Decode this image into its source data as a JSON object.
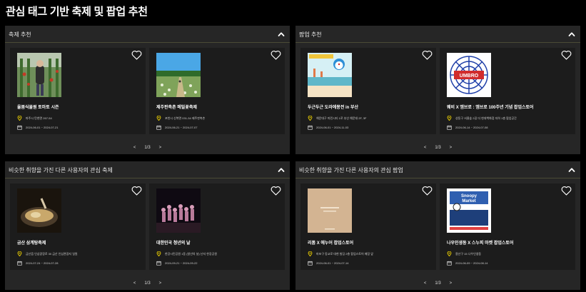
{
  "page_title": "관심 태그 기반 축제 및 팝업 추천",
  "sections": [
    {
      "title": "축제 추천",
      "pager": {
        "prev": "<",
        "page": "1/3",
        "next": ">"
      },
      "cards": [
        {
          "title": "율봄식물원 토마토 시즌",
          "address": "파주시 탄현면 267-54",
          "dates": "2024-06-01 ~ 2024-07-21",
          "thumb": "tomato-farm-photo"
        },
        {
          "title": "제주판촉촌 메밀꽃축제",
          "address": "포천시 신북면 031-34 제주판촉촌",
          "dates": "2024-06-21 ~ 2024-07-07",
          "thumb": "buckwheat-field-photo"
        }
      ]
    },
    {
      "title": "팝업 추천",
      "pager": {
        "prev": "<",
        "page": "1/3",
        "next": ">"
      },
      "cards": [
        {
          "title": "두근두근 도라에몽전 in 부산",
          "address": "해운대구 마린시티 1로 부산 해운대 2F, 3F",
          "dates": "2024-06-01 ~ 2024-11-03",
          "thumb": "doraemon-poster"
        },
        {
          "title": "웨비 X 엠브로 : 엠브로 100주년 기념 팝업스토어",
          "address": "성동구 서울숲 2길 더 현대백화점 지하 1층 팝업공간",
          "dates": "2024-06-14 ~ 2024-07-08",
          "thumb": "umbro-logo"
        }
      ]
    },
    {
      "title": "비슷한 취향을 가진 다른 사용자의 관심 축제",
      "pager": {
        "prev": "<",
        "page": "1/3",
        "next": ">"
      },
      "cards": [
        {
          "title": "금산 삼계탕축제",
          "address": "금산읍 인삼광장로 30 금산 인삼관광지 일원",
          "dates": "2024-07-24 ~ 2024-07-28",
          "thumb": "samgyetang-photo"
        },
        {
          "title": "대한민국 청년의 날",
          "address": "한강시민공원 1동 (청년의 날) 난지 한강공원",
          "dates": "2024-09-21 ~ 2024-09-22",
          "thumb": "youth-concert-photo"
        }
      ]
    },
    {
      "title": "비슷한 취향을 가진 다른 사용자의 관심 팝업",
      "pager": {
        "prev": "<",
        "page": "1/3",
        "next": ">"
      },
      "cards": [
        {
          "title": "리폼 X 에누어 팝업스토어",
          "address": "마포구 동교로 대현 빌딩 2층 팝업스토어 매장 앞",
          "dates": "2024-06-01 ~ 2024-07-14",
          "thumb": "beige-book-cover"
        },
        {
          "title": "나우인생동 X 스누피 마켓 팝업스토어",
          "address": "용산구 15 나우인생동",
          "dates": "2024-06-09 ~ 2024-08-14",
          "thumb": "snoopy-market-poster"
        }
      ]
    }
  ]
}
